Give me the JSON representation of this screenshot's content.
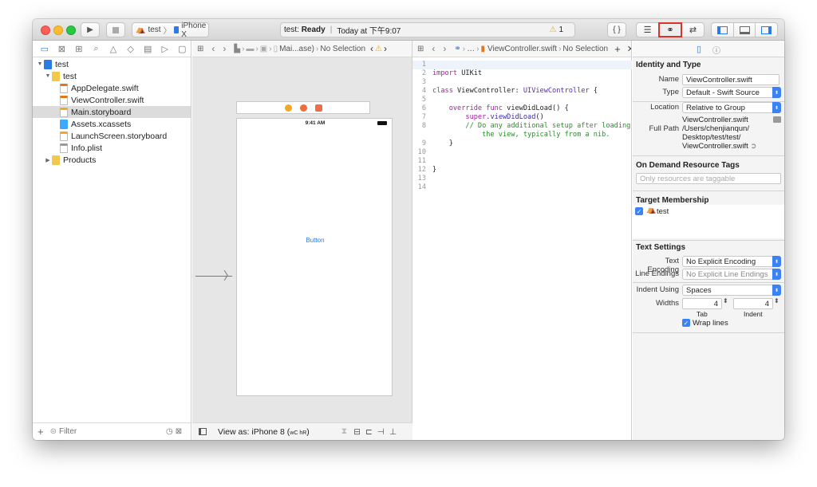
{
  "toolbar": {
    "scheme_name": "test",
    "device_name": "iPhone X",
    "activity_status_prefix": "test: ",
    "activity_status": "Ready",
    "activity_separator": "|",
    "activity_time": "Today at 下午9:07",
    "warning_count": "1"
  },
  "navigator": {
    "tree": [
      {
        "label": "test",
        "level": 0,
        "kind": "project",
        "disclosure": "▼"
      },
      {
        "label": "test",
        "level": 1,
        "kind": "folder",
        "disclosure": "▼"
      },
      {
        "label": "AppDelegate.swift",
        "level": 2,
        "kind": "swift"
      },
      {
        "label": "ViewController.swift",
        "level": 2,
        "kind": "swift"
      },
      {
        "label": "Main.storyboard",
        "level": 2,
        "kind": "storyboard",
        "selected": true
      },
      {
        "label": "Assets.xcassets",
        "level": 2,
        "kind": "assets"
      },
      {
        "label": "LaunchScreen.storyboard",
        "level": 2,
        "kind": "storyboard"
      },
      {
        "label": "Info.plist",
        "level": 2,
        "kind": "plist"
      },
      {
        "label": "Products",
        "level": 1,
        "kind": "folder",
        "disclosure": "▶"
      }
    ],
    "filter_placeholder": "Filter"
  },
  "storyboard": {
    "breadcrumb_last": "Mai...ase)",
    "breadcrumb_selection": "No Selection",
    "status_time": "9:41 AM",
    "button_label": "Button",
    "view_as_label": "View as: iPhone 8 (",
    "view_as_traits": "wC hR",
    "view_as_close": ")"
  },
  "editor": {
    "breadcrumb_file": "ViewController.swift",
    "breadcrumb_selection": "No Selection",
    "code": [
      {
        "n": "1",
        "html": ""
      },
      {
        "n": "2",
        "html": "<span class=\"kw\">import</span> UIKit"
      },
      {
        "n": "3",
        "html": ""
      },
      {
        "n": "4",
        "html": "<span class=\"kw\">class</span> ViewController: <span class=\"ty\">UIViewController</span> {"
      },
      {
        "n": "5",
        "html": ""
      },
      {
        "n": "6",
        "html": "    <span class=\"kw\">override func</span> viewDidLoad() {"
      },
      {
        "n": "7",
        "html": "        <span class=\"kw\">super</span>.<span class=\"fn\">viewDidLoad</span>()"
      },
      {
        "n": "8",
        "html": "        <span class=\"cm\">// Do any additional setup after loading</span>"
      },
      {
        "n": "",
        "html": "<span class=\"cm\">            the view, typically from a nib.</span>"
      },
      {
        "n": "9",
        "html": "    }"
      },
      {
        "n": "10",
        "html": ""
      },
      {
        "n": "11",
        "html": ""
      },
      {
        "n": "12",
        "html": "}"
      },
      {
        "n": "13",
        "html": ""
      },
      {
        "n": "14",
        "html": ""
      }
    ]
  },
  "inspector": {
    "identity_title": "Identity and Type",
    "name_label": "Name",
    "name_value": "ViewController.swift",
    "type_label": "Type",
    "type_value": "Default - Swift Source",
    "location_label": "Location",
    "location_value": "Relative to Group",
    "location_file": "ViewController.swift",
    "full_path_label": "Full Path",
    "full_path_line1": "/Users/chenjianqun/",
    "full_path_line2": "Desktop/test/test/",
    "full_path_line3": "ViewController.swift",
    "on_demand_title": "On Demand Resource Tags",
    "tags_placeholder": "Only resources are taggable",
    "target_title": "Target Membership",
    "target_name": "test",
    "text_settings_title": "Text Settings",
    "encoding_label": "Text Encoding",
    "encoding_value": "No Explicit Encoding",
    "line_endings_label": "Line Endings",
    "line_endings_value": "No Explicit Line Endings",
    "indent_using_label": "Indent Using",
    "indent_using_value": "Spaces",
    "widths_label": "Widths",
    "tab_width": "4",
    "indent_width": "4",
    "tab_caption": "Tab",
    "indent_caption": "Indent",
    "wrap_lines_label": "Wrap lines"
  },
  "colors": {
    "accent": "#3b82f6",
    "highlight_red": "#d9342b",
    "warning_yellow": "#e8b100",
    "folder_yellow": "#f2c94c"
  }
}
